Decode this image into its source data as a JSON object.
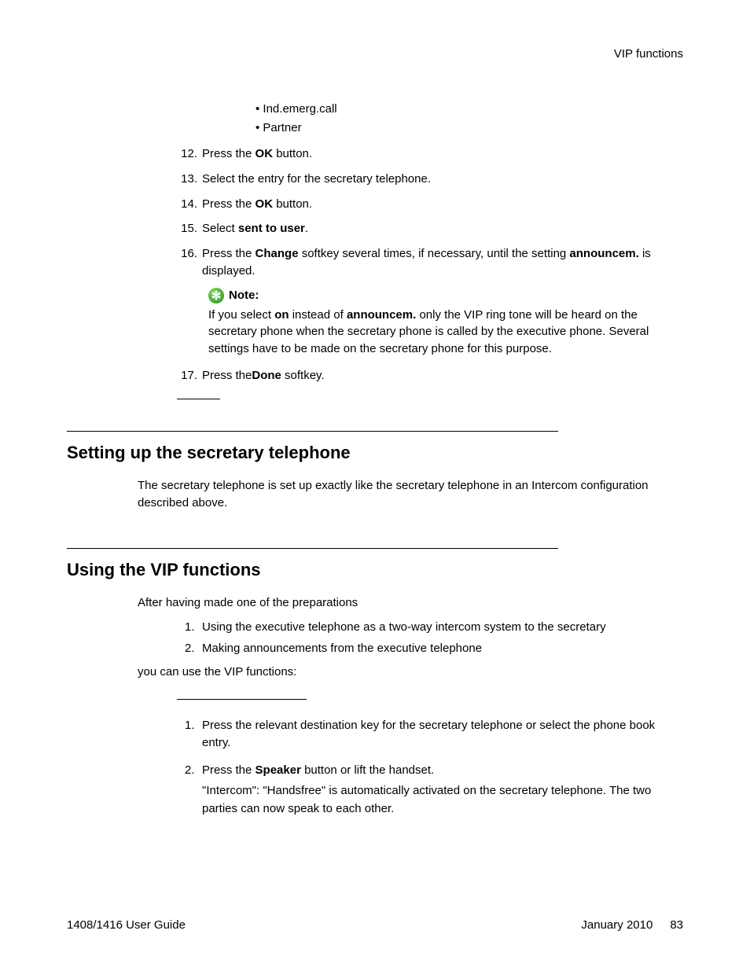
{
  "header": {
    "section_label": "VIP functions"
  },
  "bullets": {
    "b1": "Ind.emerg.call",
    "b2": "Partner"
  },
  "steps": {
    "s12": {
      "num": "12.",
      "p1": "Press the ",
      "b1": "OK",
      "p2": " button."
    },
    "s13": {
      "num": "13.",
      "p1": "Select the entry for the secretary telephone."
    },
    "s14": {
      "num": "14.",
      "p1": "Press the ",
      "b1": "OK",
      "p2": " button."
    },
    "s15": {
      "num": "15.",
      "p1": "Select ",
      "b1": "sent to user",
      "p2": "."
    },
    "s16": {
      "num": "16.",
      "p1": "Press the ",
      "b1": "Change",
      "p2": " softkey several times, if necessary, until the setting ",
      "b2": "announcem.",
      "p3": " is displayed."
    },
    "s17": {
      "num": "17.",
      "p1": "Press the",
      "b1": "Done",
      "p2": " softkey."
    }
  },
  "note": {
    "label": "Note:",
    "t1": "If you select ",
    "b1": "on",
    "t2": " instead of ",
    "b2": "announcem.",
    "t3": " only the VIP ring tone will be heard on the secretary phone when the secretary phone is called by the executive phone. Several settings have to be made on the secretary phone for this purpose."
  },
  "section1": {
    "title": "Setting up the secretary telephone",
    "body": "The secretary telephone is set up exactly like the secretary telephone in an Intercom configuration described above."
  },
  "section2": {
    "title": "Using the VIP functions",
    "intro": "After having made one of the preparations",
    "prep1": {
      "num": "1.",
      "text": "Using the executive telephone as a two-way intercom system to the secretary"
    },
    "prep2": {
      "num": "2.",
      "text": "Making announcements from the executive telephone"
    },
    "outro": "you can use the VIP functions:",
    "step1": {
      "num": "1.",
      "text": "Press the relevant destination key for the secretary telephone or select the phone book entry."
    },
    "step2": {
      "num": "2.",
      "p1": "Press the ",
      "b1": "Speaker",
      "p2": " button or lift the handset.",
      "p3": "\"Intercom\": \"Handsfree\" is automatically activated on the secretary telephone. The two parties can now speak to each other."
    }
  },
  "footer": {
    "left": "1408/1416 User Guide",
    "date": "January 2010",
    "page": "83"
  }
}
